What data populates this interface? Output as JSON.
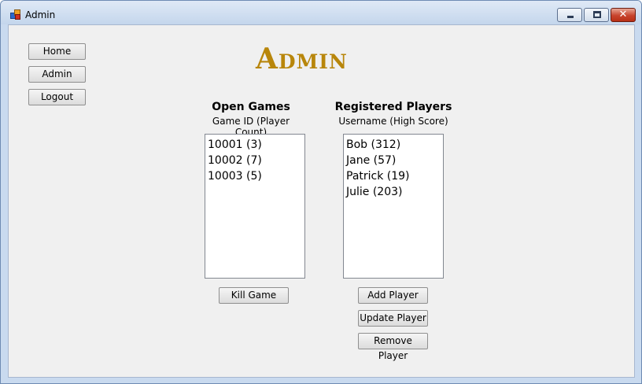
{
  "window": {
    "title": "Admin"
  },
  "nav": {
    "home": "Home",
    "admin": "Admin",
    "logout": "Logout"
  },
  "heading": "Admin",
  "open_games": {
    "title": "Open Games",
    "subtitle": "Game ID (Player Count)",
    "items": [
      "10001 (3)",
      "10002 (7)",
      "10003 (5)"
    ],
    "kill_label": "Kill Game"
  },
  "players": {
    "title": "Registered Players",
    "subtitle": "Username (High Score)",
    "items": [
      "Bob (312)",
      "Jane (57)",
      "Patrick (19)",
      "Julie (203)"
    ],
    "add_label": "Add Player",
    "update_label": "Update Player",
    "remove_label": "Remove Player"
  },
  "colors": {
    "heading": "#b8860b",
    "titlebar": "#c9daef",
    "close_button": "#c7442d"
  },
  "icons": [
    "app-icon",
    "minimize-icon",
    "maximize-icon",
    "close-icon"
  ]
}
